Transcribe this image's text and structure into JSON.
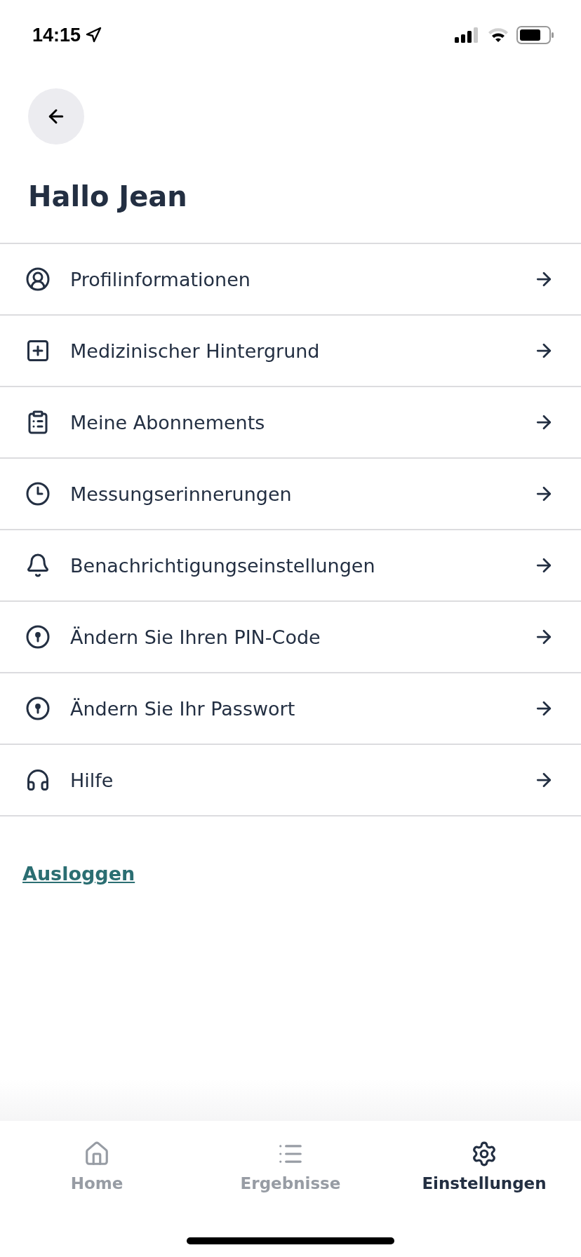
{
  "status_bar": {
    "time": "14:15"
  },
  "title": "Hallo Jean",
  "menu_items": [
    {
      "kind": "profile",
      "label": "Profilinformationen"
    },
    {
      "kind": "medical",
      "label": "Medizinischer Hintergrund"
    },
    {
      "kind": "clipboard",
      "label": "Meine Abonnements"
    },
    {
      "kind": "clock",
      "label": "Messungserinnerungen"
    },
    {
      "kind": "bell",
      "label": "Benachrichtigungseinstellungen"
    },
    {
      "kind": "keyhole",
      "label": "Ändern Sie Ihren PIN-Code"
    },
    {
      "kind": "keyhole",
      "label": "Ändern Sie Ihr Passwort"
    },
    {
      "kind": "headphones",
      "label": "Hilfe"
    }
  ],
  "logout_link": "Ausloggen",
  "tab_bar": [
    {
      "kind": "home",
      "label": "Home",
      "selected": false
    },
    {
      "kind": "list",
      "label": "Ergebnisse",
      "selected": false
    },
    {
      "kind": "settings",
      "label": "Einstellungen",
      "selected": true
    }
  ]
}
